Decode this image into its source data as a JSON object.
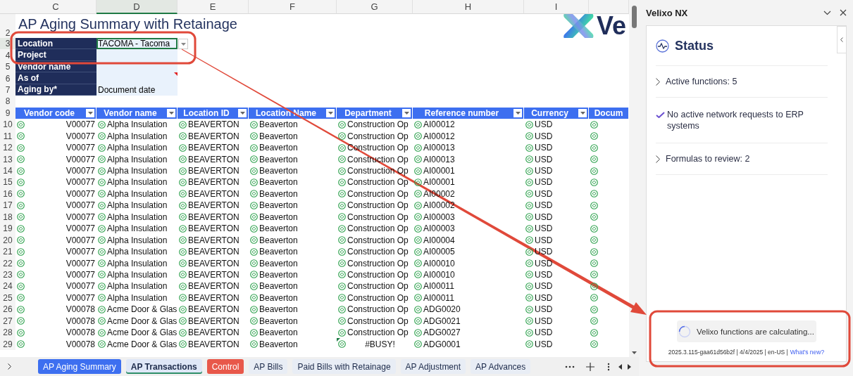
{
  "sheet": {
    "columns": [
      {
        "letter": "C",
        "selected": false
      },
      {
        "letter": "D",
        "selected": true
      },
      {
        "letter": "E",
        "selected": false
      },
      {
        "letter": "F",
        "selected": false
      },
      {
        "letter": "G",
        "selected": false
      },
      {
        "letter": "H",
        "selected": false
      },
      {
        "letter": "I",
        "selected": false
      }
    ],
    "title_row": "2",
    "title": "AP Aging Summary with Retainage",
    "logo": {
      "text": "Ve"
    },
    "filters": [
      {
        "row": "3",
        "label": "Location",
        "value": "TACOMA - Tacoma",
        "selected": true,
        "note": false
      },
      {
        "row": "4",
        "label": "Project",
        "selected": false,
        "note": false
      },
      {
        "row": "5",
        "label": "Vendor name",
        "selected": false,
        "note": false
      },
      {
        "row": "6",
        "label": "As of",
        "selected": false,
        "note": true
      },
      {
        "row": "7",
        "label": "Aging by*",
        "value": "Document date",
        "selected": false,
        "note": false
      }
    ],
    "blank_row": "8",
    "table": {
      "header_row": "9",
      "columns": [
        "Vendor code",
        "Vendor name",
        "Location ID",
        "Location Name",
        "Department",
        "Reference number",
        "Currency",
        "Docum"
      ],
      "rows": [
        {
          "row": "10",
          "cells": [
            "V00077",
            "Alpha Insulation",
            "BEAVERTON",
            "Beaverton",
            "Construction Op",
            "AI00012",
            "USD"
          ],
          "flagged": false
        },
        {
          "row": "11",
          "cells": [
            "V00077",
            "Alpha Insulation",
            "BEAVERTON",
            "Beaverton",
            "Construction Op",
            "AI00012",
            "USD"
          ],
          "flagged": false
        },
        {
          "row": "12",
          "cells": [
            "V00077",
            "Alpha Insulation",
            "BEAVERTON",
            "Beaverton",
            "Construction Op",
            "AI00013",
            "USD"
          ],
          "flagged": false
        },
        {
          "row": "13",
          "cells": [
            "V00077",
            "Alpha Insulation",
            "BEAVERTON",
            "Beaverton",
            "Construction Op",
            "AI00013",
            "USD"
          ],
          "flagged": false
        },
        {
          "row": "14",
          "cells": [
            "V00077",
            "Alpha Insulation",
            "BEAVERTON",
            "Beaverton",
            "Construction Op",
            "AI00001",
            "USD"
          ],
          "flagged": false
        },
        {
          "row": "15",
          "cells": [
            "V00077",
            "Alpha Insulation",
            "BEAVERTON",
            "Beaverton",
            "Construction Op",
            "AI00001",
            "USD"
          ],
          "flagged": false
        },
        {
          "row": "16",
          "cells": [
            "V00077",
            "Alpha Insulation",
            "BEAVERTON",
            "Beaverton",
            "Construction Op",
            "AI00002",
            "USD"
          ],
          "flagged": false
        },
        {
          "row": "17",
          "cells": [
            "V00077",
            "Alpha Insulation",
            "BEAVERTON",
            "Beaverton",
            "Construction Op",
            "AI00002",
            "USD"
          ],
          "flagged": false
        },
        {
          "row": "18",
          "cells": [
            "V00077",
            "Alpha Insulation",
            "BEAVERTON",
            "Beaverton",
            "Construction Op",
            "AI00003",
            "USD"
          ],
          "flagged": false
        },
        {
          "row": "19",
          "cells": [
            "V00077",
            "Alpha Insulation",
            "BEAVERTON",
            "Beaverton",
            "Construction Op",
            "AI00003",
            "USD"
          ],
          "flagged": false
        },
        {
          "row": "20",
          "cells": [
            "V00077",
            "Alpha Insulation",
            "BEAVERTON",
            "Beaverton",
            "Construction Op",
            "AI00004",
            "USD"
          ],
          "flagged": false
        },
        {
          "row": "21",
          "cells": [
            "V00077",
            "Alpha Insulation",
            "BEAVERTON",
            "Beaverton",
            "Construction Op",
            "AI00005",
            "USD"
          ],
          "flagged": false
        },
        {
          "row": "22",
          "cells": [
            "V00077",
            "Alpha Insulation",
            "BEAVERTON",
            "Beaverton",
            "Construction Op",
            "AI00010",
            "USD"
          ],
          "flagged": false
        },
        {
          "row": "23",
          "cells": [
            "V00077",
            "Alpha Insulation",
            "BEAVERTON",
            "Beaverton",
            "Construction Op",
            "AI00010",
            "USD"
          ],
          "flagged": false
        },
        {
          "row": "24",
          "cells": [
            "V00077",
            "Alpha Insulation",
            "BEAVERTON",
            "Beaverton",
            "Construction Op",
            "AI00011",
            "USD"
          ],
          "flagged": false
        },
        {
          "row": "25",
          "cells": [
            "V00077",
            "Alpha Insulation",
            "BEAVERTON",
            "Beaverton",
            "Construction Op",
            "AI00011",
            "USD"
          ],
          "flagged": false
        },
        {
          "row": "26",
          "cells": [
            "V00078",
            "Acme Door & Glas",
            "BEAVERTON",
            "Beaverton",
            "Construction Op",
            "ADG0020",
            "USD"
          ],
          "flagged": false
        },
        {
          "row": "27",
          "cells": [
            "V00078",
            "Acme Door & Glas",
            "BEAVERTON",
            "Beaverton",
            "Construction Op",
            "ADG0021",
            "USD"
          ],
          "flagged": false
        },
        {
          "row": "28",
          "cells": [
            "V00078",
            "Acme Door & Glas",
            "BEAVERTON",
            "Beaverton",
            "Construction Op",
            "ADG0027",
            "USD"
          ],
          "flagged": false
        },
        {
          "row": "29",
          "cells": [
            "V00078",
            "Acme Door & Glas",
            "BEAVERTON",
            "Beaverton",
            "#BUSY!",
            "ADG0001",
            "USD"
          ],
          "flagged": true
        }
      ]
    }
  },
  "sheet_tabs": [
    {
      "label": "AP Aging Summary",
      "selected": false,
      "color": "#3d6ff0"
    },
    {
      "label": "AP Transactions",
      "selected": true,
      "color": "#dfe7f7"
    },
    {
      "label": "Control",
      "selected": false,
      "color": "#e8584a"
    },
    {
      "label": "AP Bills",
      "selected": false,
      "color": "#e8edf5"
    },
    {
      "label": "Paid Bills with Retainage",
      "selected": false,
      "color": "#e8edf5"
    },
    {
      "label": "AP Adjustment",
      "selected": false,
      "color": "#e8edf5"
    },
    {
      "label": "AP Advances",
      "selected": false,
      "color": "#e8edf5"
    }
  ],
  "panel": {
    "title": "Velixo NX",
    "heading": "Status",
    "items": [
      {
        "kind": "expandable",
        "text": "Active functions: 5"
      },
      {
        "kind": "check",
        "text": "No active network requests to ERP systems"
      },
      {
        "kind": "expandable",
        "text": "Formulas to review: 2"
      }
    ],
    "progress": "Velixo functions are calculating...",
    "footer": "2025.3.115-gaa61d56b2f | 4/4/2025 | en-US |",
    "footer_link": "What's new?"
  }
}
